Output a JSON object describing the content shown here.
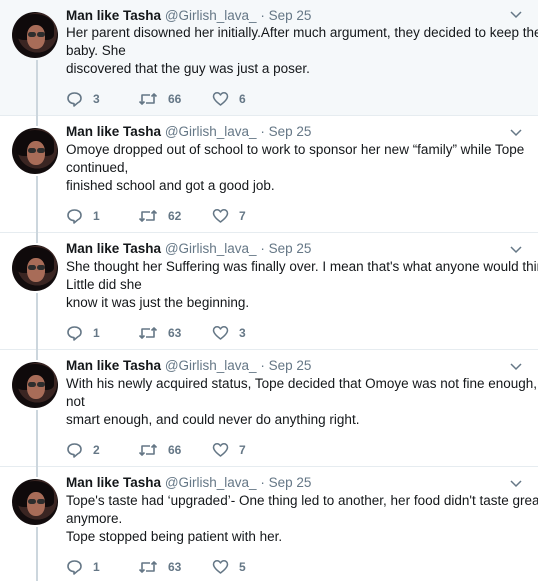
{
  "tweets": [
    {
      "name": "Man like Tasha",
      "handle": "@Girlish_lava_",
      "separator": "·",
      "date": "Sep 25",
      "lines": [
        "Her parent disowned her initially.After much argument, they decided to keep the",
        "baby. She",
        "discovered that the guy was just a poser."
      ],
      "replies": "3",
      "retweets": "66",
      "likes": "6"
    },
    {
      "name": "Man like Tasha",
      "handle": "@Girlish_lava_",
      "separator": "·",
      "date": "Sep 25",
      "lines": [
        "Omoye dropped out of school to work to sponsor her new “family” while Tope",
        "continued,",
        "finished school and got a good job."
      ],
      "replies": "1",
      "retweets": "62",
      "likes": "7"
    },
    {
      "name": "Man like Tasha",
      "handle": "@Girlish_lava_",
      "separator": "·",
      "date": "Sep 25",
      "lines": [
        "She thought her Suffering was finally over. I mean that's what anyone would think.",
        "Little did she",
        "know it was just the beginning."
      ],
      "replies": "1",
      "retweets": "63",
      "likes": "3"
    },
    {
      "name": "Man like Tasha",
      "handle": "@Girlish_lava_",
      "separator": "·",
      "date": "Sep 25",
      "lines": [
        "With his newly acquired status, Tope decided that Omoye was not fine enough,",
        "not",
        "smart enough, and could never do anything right."
      ],
      "replies": "2",
      "retweets": "66",
      "likes": "7"
    },
    {
      "name": "Man like Tasha",
      "handle": "@Girlish_lava_",
      "separator": "·",
      "date": "Sep 25",
      "lines": [
        "Tope's taste had ‘upgraded’- One thing led to another, her food didn't taste great",
        "anymore.",
        "Tope stopped being patient with her."
      ],
      "replies": "1",
      "retweets": "63",
      "likes": "5"
    }
  ],
  "icons": {
    "reply": "reply-icon",
    "retweet": "retweet-icon",
    "like": "like-icon",
    "more": "chevron-down-icon"
  },
  "colors": {
    "thread_line": "#ccd6dd",
    "icon_gray": "#657786",
    "highlight_bg": "#f5f8fa"
  }
}
